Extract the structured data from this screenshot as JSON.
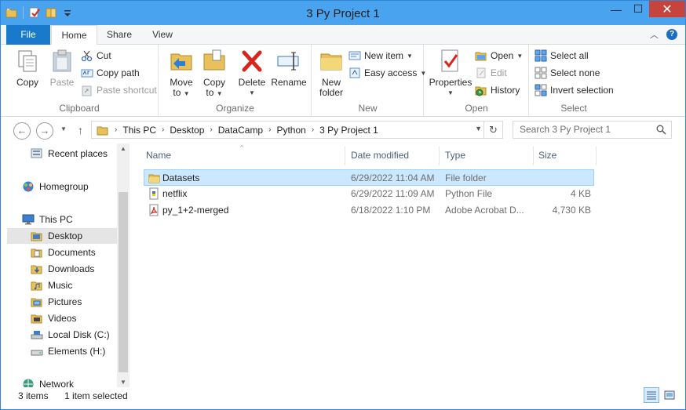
{
  "window": {
    "title": "3 Py Project 1",
    "controls": {
      "minimize": "—",
      "maximize": "☐",
      "close": "✕"
    }
  },
  "tabs": [
    {
      "label": "File"
    },
    {
      "label": "Home"
    },
    {
      "label": "Share"
    },
    {
      "label": "View"
    }
  ],
  "ribbon": {
    "clipboard": {
      "label": "Clipboard",
      "copy": "Copy",
      "paste": "Paste",
      "cut": "Cut",
      "copy_path": "Copy path",
      "paste_shortcut": "Paste shortcut"
    },
    "organize": {
      "label": "Organize",
      "move_to_line1": "Move",
      "move_to_line2": "to",
      "copy_to_line1": "Copy",
      "copy_to_line2": "to",
      "delete_line1": "Delete",
      "rename": "Rename"
    },
    "new": {
      "label": "New",
      "new_folder_line1": "New",
      "new_folder_line2": "folder",
      "new_item": "New item",
      "easy_access": "Easy access"
    },
    "open": {
      "label": "Open",
      "properties": "Properties",
      "open": "Open",
      "edit": "Edit",
      "history": "History"
    },
    "select": {
      "label": "Select",
      "select_all": "Select all",
      "select_none": "Select none",
      "invert_selection": "Invert selection"
    }
  },
  "address": {
    "crumbs": [
      "This PC",
      "Desktop",
      "DataCamp",
      "Python",
      "3 Py Project 1"
    ]
  },
  "search": {
    "placeholder": "Search 3 Py Project 1"
  },
  "navpane": {
    "recent_places": "Recent places",
    "homegroup": "Homegroup",
    "this_pc": "This PC",
    "desktop": "Desktop",
    "documents": "Documents",
    "downloads": "Downloads",
    "music": "Music",
    "pictures": "Pictures",
    "videos": "Videos",
    "local_disk": "Local Disk (C:)",
    "elements": "Elements (H:)",
    "network": "Network"
  },
  "columns": {
    "name": "Name",
    "date_modified": "Date modified",
    "type": "Type",
    "size": "Size"
  },
  "files": [
    {
      "name": "Datasets",
      "date": "6/29/2022 11:04 AM",
      "type": "File folder",
      "size": ""
    },
    {
      "name": "netflix",
      "date": "6/29/2022 11:09 AM",
      "type": "Python File",
      "size": "4 KB"
    },
    {
      "name": "py_1+2-merged",
      "date": "6/18/2022 1:10 PM",
      "type": "Adobe Acrobat D...",
      "size": "4,730 KB"
    }
  ],
  "status": {
    "items": "3 items",
    "selected": "1 item selected"
  },
  "colors": {
    "titlebar": "#4aa3ef",
    "file_tab": "#1979ca",
    "selection": "#cce8ff",
    "selection_border": "#99d1ff",
    "folder": "#e8c15c"
  }
}
